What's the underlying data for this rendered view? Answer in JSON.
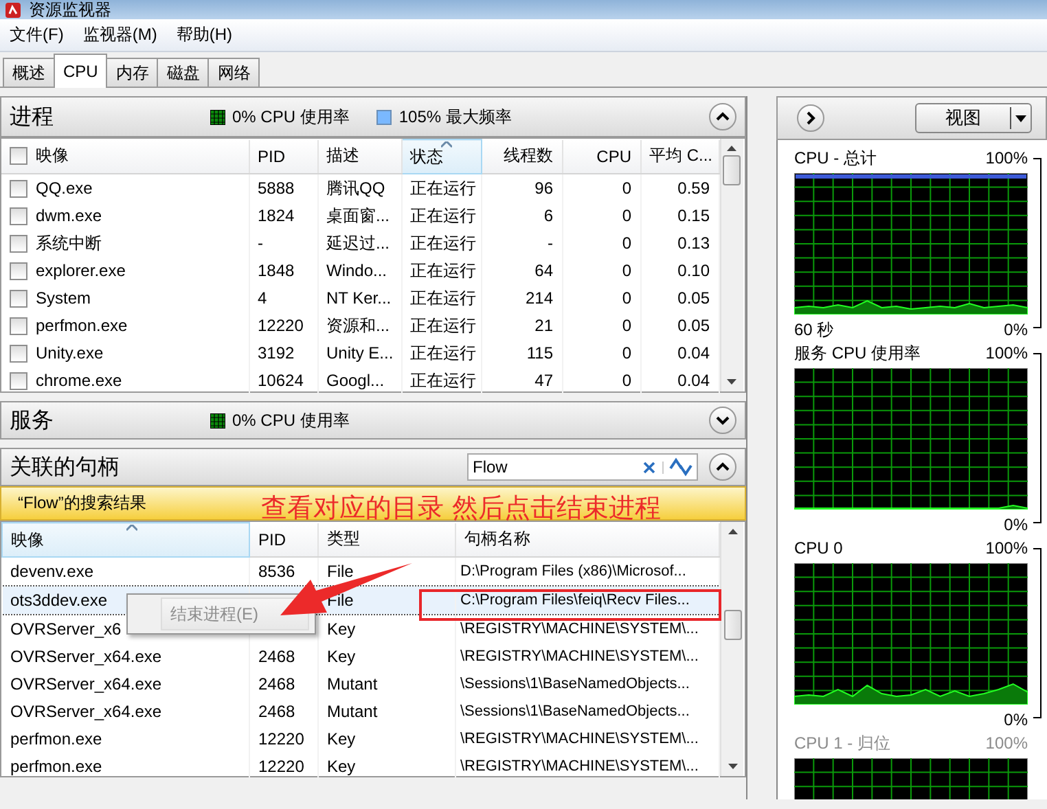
{
  "window": {
    "title": "资源监视器"
  },
  "menu": [
    "文件(F)",
    "监视器(M)",
    "帮助(H)"
  ],
  "tabs": [
    {
      "label": "概述",
      "selected": false
    },
    {
      "label": "CPU",
      "selected": true
    },
    {
      "label": "内存",
      "selected": false
    },
    {
      "label": "磁盘",
      "selected": false
    },
    {
      "label": "网络",
      "selected": false
    }
  ],
  "processes": {
    "title": "进程",
    "cpu_usage": "0% CPU 使用率",
    "max_frequency": "105% 最大频率",
    "expanded": true,
    "all_checked": false,
    "columns": [
      {
        "label": "映像",
        "sorted": false
      },
      {
        "label": "PID",
        "sorted": false
      },
      {
        "label": "描述",
        "sorted": false
      },
      {
        "label": "状态",
        "sorted": true
      },
      {
        "label": "线程数",
        "sorted": false
      },
      {
        "label": "CPU",
        "sorted": false
      },
      {
        "label": "平均 C...",
        "sorted": false
      }
    ],
    "rows": [
      {
        "checked": false,
        "cells": [
          "QQ.exe",
          "5888",
          "腾讯QQ",
          "正在运行",
          "96",
          "0",
          "0.59"
        ]
      },
      {
        "checked": false,
        "cells": [
          "dwm.exe",
          "1824",
          "桌面窗...",
          "正在运行",
          "6",
          "0",
          "0.15"
        ]
      },
      {
        "checked": false,
        "cells": [
          "系统中断",
          "-",
          "延迟过...",
          "正在运行",
          "-",
          "0",
          "0.13"
        ]
      },
      {
        "checked": false,
        "cells": [
          "explorer.exe",
          "1848",
          "Windo...",
          "正在运行",
          "64",
          "0",
          "0.10"
        ]
      },
      {
        "checked": false,
        "cells": [
          "System",
          "4",
          "NT Ker...",
          "正在运行",
          "214",
          "0",
          "0.05"
        ]
      },
      {
        "checked": false,
        "cells": [
          "perfmon.exe",
          "12220",
          "资源和...",
          "正在运行",
          "21",
          "0",
          "0.05"
        ]
      },
      {
        "checked": false,
        "cells": [
          "Unity.exe",
          "3192",
          "Unity E...",
          "正在运行",
          "115",
          "0",
          "0.04"
        ]
      },
      {
        "checked": false,
        "cells": [
          "chrome.exe",
          "10624",
          "Googl...",
          "正在运行",
          "47",
          "0",
          "0.04"
        ]
      }
    ]
  },
  "services": {
    "title": "服务",
    "cpu_usage": "0% CPU 使用率",
    "expanded": false
  },
  "handles": {
    "title": "关联的句柄",
    "expanded": true,
    "search": {
      "value": "Flow"
    },
    "results_label": "“Flow”的搜索结果",
    "columns": [
      {
        "label": "映像",
        "sorted": true
      },
      {
        "label": "PID",
        "sorted": false
      },
      {
        "label": "类型",
        "sorted": false
      },
      {
        "label": "句柄名称",
        "sorted": false
      }
    ],
    "rows": [
      {
        "selected": false,
        "cells": [
          "devenv.exe",
          "8536",
          "File",
          "D:\\Program Files (x86)\\Microsof..."
        ]
      },
      {
        "selected": true,
        "cells": [
          "ots3ddev.exe",
          null,
          "File",
          "C:\\Program Files\\feiq\\Recv Files..."
        ]
      },
      {
        "selected": false,
        "cells": [
          "OVRServer_x6",
          null,
          "Key",
          "\\REGISTRY\\MACHINE\\SYSTEM\\..."
        ]
      },
      {
        "selected": false,
        "cells": [
          "OVRServer_x64.exe",
          "2468",
          "Key",
          "\\REGISTRY\\MACHINE\\SYSTEM\\..."
        ]
      },
      {
        "selected": false,
        "cells": [
          "OVRServer_x64.exe",
          "2468",
          "Mutant",
          "\\Sessions\\1\\BaseNamedObjects..."
        ]
      },
      {
        "selected": false,
        "cells": [
          "OVRServer_x64.exe",
          "2468",
          "Mutant",
          "\\Sessions\\1\\BaseNamedObjects..."
        ]
      },
      {
        "selected": false,
        "cells": [
          "perfmon.exe",
          "12220",
          "Key",
          "\\REGISTRY\\MACHINE\\SYSTEM\\..."
        ]
      },
      {
        "selected": false,
        "cells": [
          "perfmon.exe",
          "12220",
          "Key",
          "\\REGISTRY\\MACHINE\\SYSTEM\\..."
        ]
      }
    ]
  },
  "context_menu": {
    "items": [
      {
        "label": "结束进程(E)",
        "disabled": true
      }
    ]
  },
  "annotation": {
    "text": "查看对应的目录 然后点击结束进程"
  },
  "right_panel": {
    "view_button": "视图",
    "graphs": [
      {
        "title": "CPU - 总计",
        "max": "100%",
        "time": "60 秒",
        "min": "0%",
        "disabled": false
      },
      {
        "title": "服务 CPU 使用率",
        "max": "100%",
        "min": "0%",
        "disabled": false
      },
      {
        "title": "CPU 0",
        "max": "100%",
        "min": "0%",
        "disabled": false
      },
      {
        "title": "CPU 1 - 归位",
        "max": "100%",
        "disabled": true
      }
    ]
  }
}
